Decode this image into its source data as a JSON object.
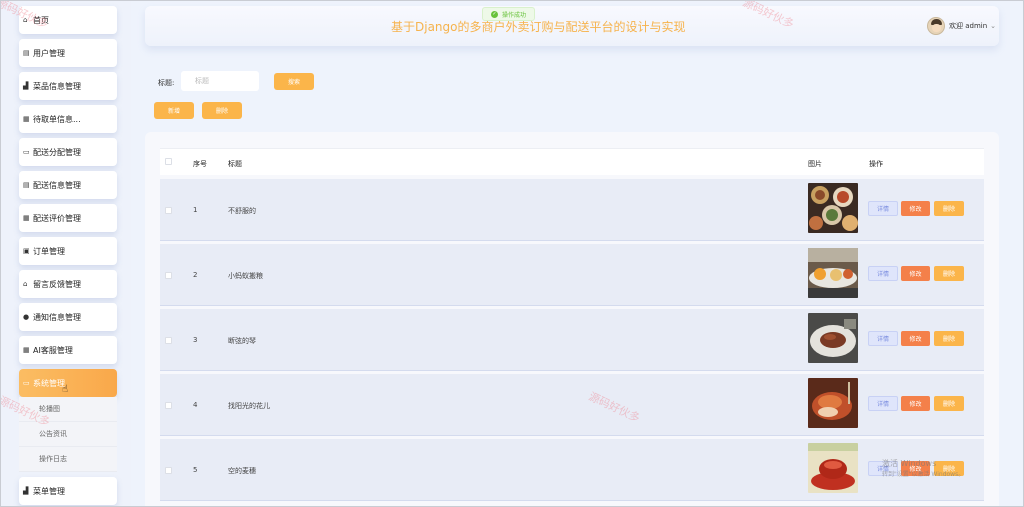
{
  "sidebar": {
    "items": [
      {
        "label": "首页",
        "icon": "home-icon",
        "glyph": "⌂"
      },
      {
        "label": "用户管理",
        "icon": "user-table-icon",
        "glyph": "▤"
      },
      {
        "label": "菜品信息管理",
        "icon": "people-icon",
        "glyph": "▟"
      },
      {
        "label": "待取单信息...",
        "icon": "grid-icon",
        "glyph": "▦"
      },
      {
        "label": "配送分配管理",
        "icon": "briefcase-icon",
        "glyph": "▭"
      },
      {
        "label": "配送信息管理",
        "icon": "list-icon",
        "glyph": "▤"
      },
      {
        "label": "配送评价管理",
        "icon": "grid-icon",
        "glyph": "▦"
      },
      {
        "label": "订单管理",
        "icon": "order-icon",
        "glyph": "▣"
      },
      {
        "label": "留言反馈管理",
        "icon": "home-icon",
        "glyph": "⌂"
      },
      {
        "label": "通知信息管理",
        "icon": "bell-icon",
        "glyph": "●"
      },
      {
        "label": "AI客服管理",
        "icon": "grid-icon",
        "glyph": "▦"
      },
      {
        "label": "系统管理",
        "icon": "system-icon",
        "glyph": "▭"
      },
      {
        "label": "菜单管理",
        "icon": "people-icon",
        "glyph": "▟"
      }
    ],
    "submenu": [
      "轮播图",
      "公告资讯",
      "操作日志"
    ]
  },
  "header": {
    "title": "基于Django的多商户外卖订购与配送平台的设计与实现",
    "welcome": "欢迎 admin"
  },
  "toast": {
    "text": "操作成功"
  },
  "search": {
    "label": "标题:",
    "placeholder": "标题",
    "button": "搜索"
  },
  "actions": {
    "add": "新增",
    "delete": "删除"
  },
  "table": {
    "columns": {
      "index": "序号",
      "title": "标题",
      "image": "图片",
      "ops": "操作"
    },
    "row_actions": {
      "detail": "详情",
      "edit": "修改",
      "delete": "删除"
    },
    "rows": [
      {
        "index": "1",
        "title": "不舒服的"
      },
      {
        "index": "2",
        "title": "小蚂蚁搬粮"
      },
      {
        "index": "3",
        "title": "断弦的琴"
      },
      {
        "index": "4",
        "title": "找阳光的花儿"
      },
      {
        "index": "5",
        "title": "空的麦穗"
      }
    ]
  },
  "watermarks": [
    "源码好伙多",
    "源码好伙多",
    "源码好伙多",
    "源码好伙多"
  ],
  "windows_watermark": {
    "line1": "激活 Windows",
    "line2": "转到\"设置\"以激活 Windows。"
  },
  "colors": {
    "accent": "#fbb54a",
    "edit": "#f4804a",
    "title": "#f6b34d",
    "success": "#67c23a"
  }
}
